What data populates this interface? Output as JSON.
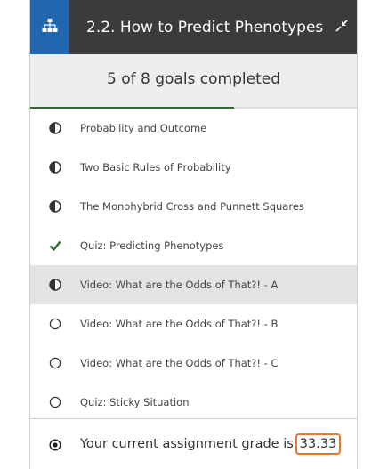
{
  "header": {
    "title": "2.2. How to Predict Phenotypes",
    "hierarchy_icon": "sitemap-icon",
    "collapse_icon": "collapse-arrows-icon",
    "accent_color": "#2266b0"
  },
  "progress": {
    "label": "5 of 8 goals completed",
    "completed": 5,
    "total": 8,
    "bar_color": "#2f6b2f"
  },
  "goals": [
    {
      "label": "Probability and Outcome",
      "status": "half",
      "icon": "half-circle-icon"
    },
    {
      "label": "Two Basic Rules of Probability",
      "status": "half",
      "icon": "half-circle-icon"
    },
    {
      "label": "The Monohybrid Cross and Punnett Squares",
      "status": "half",
      "icon": "half-circle-icon"
    },
    {
      "label": "Quiz: Predicting Phenotypes",
      "status": "complete",
      "icon": "checkmark-icon"
    },
    {
      "label": "Video: What are the Odds of That?! - A",
      "status": "half",
      "icon": "half-circle-icon",
      "active": true
    },
    {
      "label": "Video: What are the Odds of That?! - B",
      "status": "empty",
      "icon": "empty-circle-icon"
    },
    {
      "label": "Video: What are the Odds of That?! - C",
      "status": "empty",
      "icon": "empty-circle-icon"
    },
    {
      "label": "Quiz: Sticky Situation",
      "status": "empty",
      "icon": "empty-circle-icon"
    }
  ],
  "footer": {
    "prefix": "Your current assignment grade is",
    "grade": "33.33",
    "icon": "target-circle-icon",
    "highlight_color": "#e07a2e"
  }
}
